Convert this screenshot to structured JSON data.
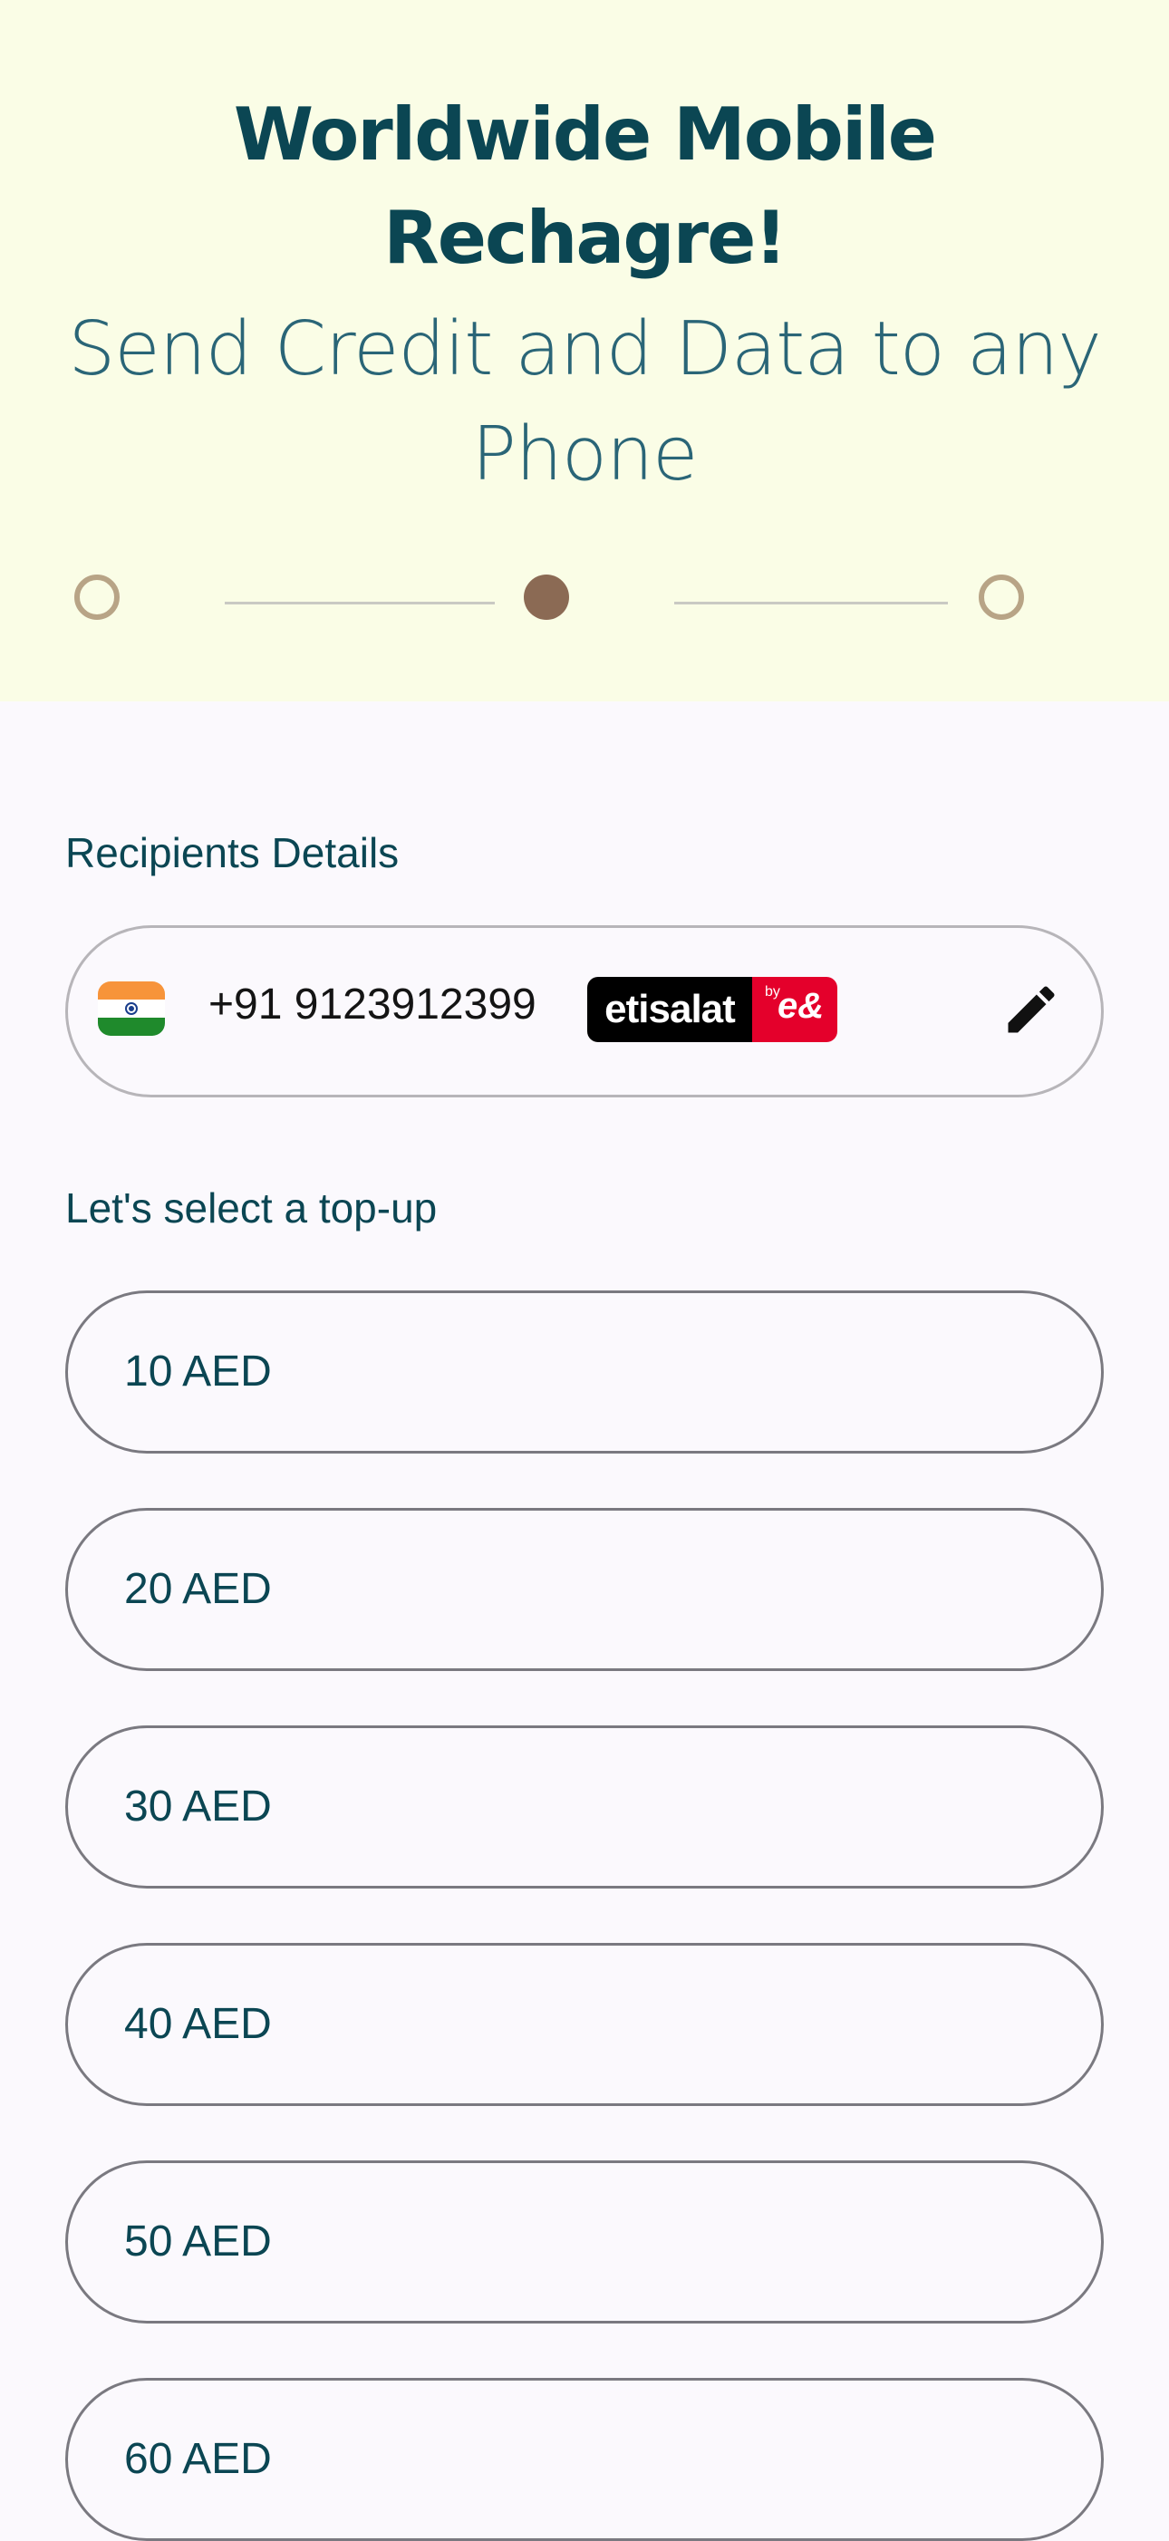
{
  "hero": {
    "title_line1": "Worldwide Mobile",
    "title_line2": "Rechagre!",
    "subtitle_line1": "Send Credit and Data to any",
    "subtitle_line2": "Phone",
    "steps": {
      "total": 3,
      "current": 2
    }
  },
  "recipient": {
    "section_label": "Recipients Details",
    "country_flag": "india-flag-icon",
    "phone_number": "+91 9123912399",
    "operator": {
      "name": "etisalat",
      "by": "by",
      "mark": "e&",
      "colors": {
        "left": "#000000",
        "right": "#e4002b"
      }
    },
    "edit_icon": "pencil-icon"
  },
  "topup": {
    "section_label": "Let's select a top-up",
    "options": [
      "10 AED",
      "20 AED",
      "30 AED",
      "40 AED",
      "50 AED",
      "60 AED"
    ]
  },
  "colors": {
    "hero_bg": "#fafde6",
    "page_bg": "#fbf9fd",
    "primary_text": "#0b4653",
    "step_active": "#8b6a54",
    "step_inactive": "#b8a486"
  }
}
